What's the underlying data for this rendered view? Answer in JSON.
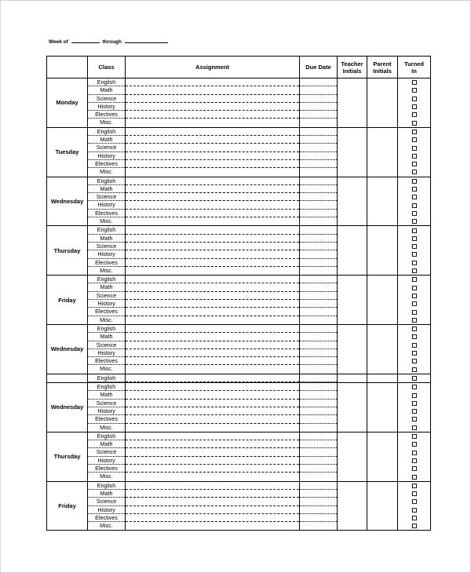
{
  "header": {
    "week_of_label": "Week of",
    "through_label": "through",
    "week_of_value": "",
    "through_value": ""
  },
  "table": {
    "columns": {
      "day": "",
      "class": "Class",
      "assignment": "Assignment",
      "due_date": "Due Date",
      "teacher_initials_line1": "Teacher",
      "teacher_initials_line2": "Initials",
      "parent_initials_line1": "Parent",
      "parent_initials_line2": "Initials",
      "turned_in_line1": "Turned",
      "turned_in_line2": "In"
    },
    "subjects": [
      "English",
      "Math",
      "Science",
      "History",
      "Electives",
      "Misc."
    ],
    "days": [
      {
        "name": "Monday",
        "rows": 6
      },
      {
        "name": "Tuesday",
        "rows": 6
      },
      {
        "name": "Wednesday",
        "rows": 6
      },
      {
        "name": "Thursday",
        "rows": 6
      },
      {
        "name": "Friday",
        "rows": 6
      },
      {
        "name": "Wednesday",
        "rows": 6
      },
      {
        "name": "",
        "rows": 1,
        "partial": true
      },
      {
        "name": "Wednesday",
        "rows": 6
      },
      {
        "name": "Thursday",
        "rows": 6
      },
      {
        "name": "Friday",
        "rows": 6
      }
    ],
    "checkbox_checked": false
  }
}
